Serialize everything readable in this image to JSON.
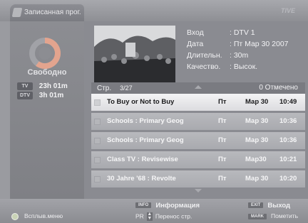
{
  "window": {
    "title": "Записанная прог.",
    "brand": "TIVE"
  },
  "storage": {
    "free_label": "Свободно",
    "free_fraction": 0.6,
    "rows": [
      {
        "badge": "TV",
        "value": "23h 01m"
      },
      {
        "badge": "DTV",
        "value": "3h 01m"
      }
    ]
  },
  "program_info": {
    "rows": [
      {
        "key": "Вход",
        "value": ": DTV 1"
      },
      {
        "key": "Дата",
        "value": ": Пт Мар 30 2007"
      },
      {
        "key": "Длительн.",
        "value": ": 30m"
      },
      {
        "key": "Качество.",
        "value": ": Высок."
      }
    ]
  },
  "page": {
    "label": "Стр.",
    "number": "3/27",
    "marked": "0 Отмечено"
  },
  "recordings": [
    {
      "title": "To Buy or Not to Buy",
      "day": "Пт",
      "date": "Мар 30",
      "time": "10:49",
      "selected": true
    },
    {
      "title": "Schools : Primary Geog",
      "day": "Пт",
      "date": "Мар 30",
      "time": "10:36",
      "selected": false
    },
    {
      "title": "Schools : Primary Geog",
      "day": "Пт",
      "date": "Мар 30",
      "time": "10:36",
      "selected": false
    },
    {
      "title": "Class TV : Revisewise",
      "day": "Пт",
      "date": "Мар30",
      "time": "10:21",
      "selected": false
    },
    {
      "title": "30 Jahre '68 : Revolte",
      "day": "Пт",
      "date": "Мар 30",
      "time": "10:20",
      "selected": false
    }
  ],
  "footer": {
    "popup_menu": "Всплыв.меню",
    "info_key": "INFO",
    "info_label": "Информация",
    "pr_label": "PR",
    "page_move": "Перенос стр.",
    "exit_key": "EXIT",
    "exit_label": "Выход",
    "mark_key": "MARK",
    "mark_label": "Пометить"
  },
  "colors": {
    "selected_row": "#f0f0f1",
    "row": "#b1b2b6",
    "panel": "#8a8b91"
  }
}
